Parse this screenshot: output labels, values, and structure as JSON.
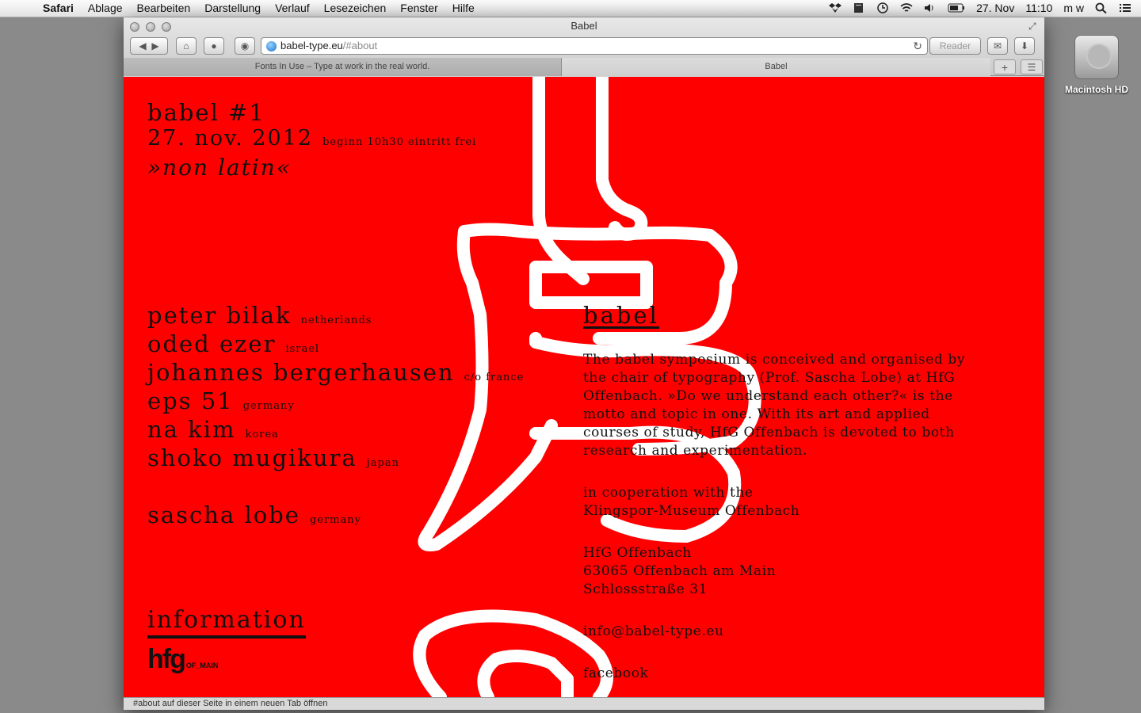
{
  "menubar": {
    "app": "Safari",
    "items": [
      "Ablage",
      "Bearbeiten",
      "Darstellung",
      "Verlauf",
      "Lesezeichen",
      "Fenster",
      "Hilfe"
    ],
    "date": "27. Nov",
    "time": "11:10",
    "user": "m w"
  },
  "desktop": {
    "disk_label": "Macintosh HD"
  },
  "window": {
    "title": "Babel",
    "url_host": "babel-type.eu",
    "url_path": "/#about",
    "reader_label": "Reader",
    "tabs": [
      {
        "label": "Fonts In Use – Type at work in the real world."
      },
      {
        "label": "Babel"
      }
    ],
    "status_text": "#about auf dieser Seite in einem neuen Tab öffnen"
  },
  "page": {
    "event_title": "babel #1",
    "event_date": "27. nov. 2012",
    "event_info": "beginn 10h30 eintritt frei",
    "motto": "»non latin«",
    "speakers": [
      {
        "name": "peter bilak",
        "country": "netherlands"
      },
      {
        "name": "oded ezer",
        "country": "israel"
      },
      {
        "name": "johannes bergerhausen",
        "country": "c/o france"
      },
      {
        "name": "eps 51",
        "country": "germany"
      },
      {
        "name": "na kim",
        "country": "korea"
      },
      {
        "name": "shoko mugikura",
        "country": "japan"
      }
    ],
    "host": {
      "name": "sascha lobe",
      "country": "germany"
    },
    "information_link": "information",
    "logo_text": "hfg",
    "logo_sub": "OF_MAIN",
    "about": {
      "heading": "babel",
      "paragraph": "The babel symposium is conceived and organised by the chair of typography (Prof. Sascha Lobe) at HfG Offenbach. »Do we understand each other?« is the motto and topic in one. With its art and applied courses of study, HfG Offenbach is devoted to both research and experimentation.",
      "coop_line1": "in cooperation with the",
      "coop_line2": "Klingspor-Museum Offenbach",
      "address_line1": "HfG Offenbach",
      "address_line2": "63065 Offenbach am Main",
      "address_line3": "Schlossstraße 31",
      "email": "info@babel-type.eu",
      "facebook": "facebook"
    },
    "colors": {
      "background": "#ff0000",
      "glyph": "#ffffff",
      "text": "#111111"
    }
  }
}
